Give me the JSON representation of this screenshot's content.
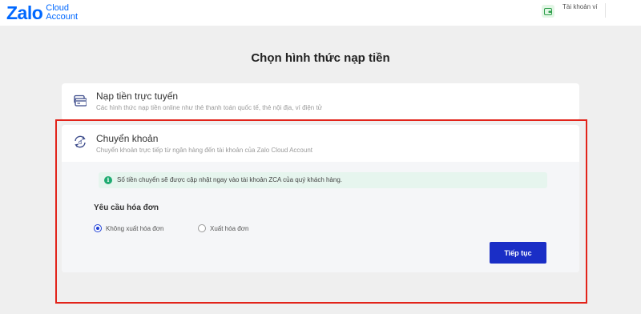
{
  "header": {
    "logo_main": "Zalo",
    "logo_line1": "Cloud",
    "logo_line2": "Account",
    "account_label": "Tài khoản ví",
    "wallet_icon": "wallet-icon"
  },
  "page_title": "Chọn hình thức nạp tiền",
  "methods": [
    {
      "title": "Nạp tiền trực tuyến",
      "description": "Các hình thức nạp tiền online như thẻ thanh toán quốc tế, thẻ nội địa, ví điện tử",
      "icon": "credit-card-icon"
    },
    {
      "title": "Chuyển khoản",
      "description": "Chuyển khoản trực tiếp từ ngân hàng đến tài khoản của Zalo Cloud Account",
      "icon": "transfer-icon"
    }
  ],
  "transfer_panel": {
    "notice": "Số tiền chuyển sẽ được cập nhật ngay vào tài khoản ZCA của quý khách hàng.",
    "invoice_title": "Yêu cầu hóa đơn",
    "options": [
      "Không xuất hóa đơn",
      "Xuất hóa đơn"
    ],
    "selected_option": "Không xuất hóa đơn",
    "continue_label": "Tiếp tục"
  },
  "colors": {
    "brand": "#0068ff",
    "button": "#1a2ec6",
    "highlight": "#e2231a",
    "notice_bg": "#e6f5ee"
  }
}
